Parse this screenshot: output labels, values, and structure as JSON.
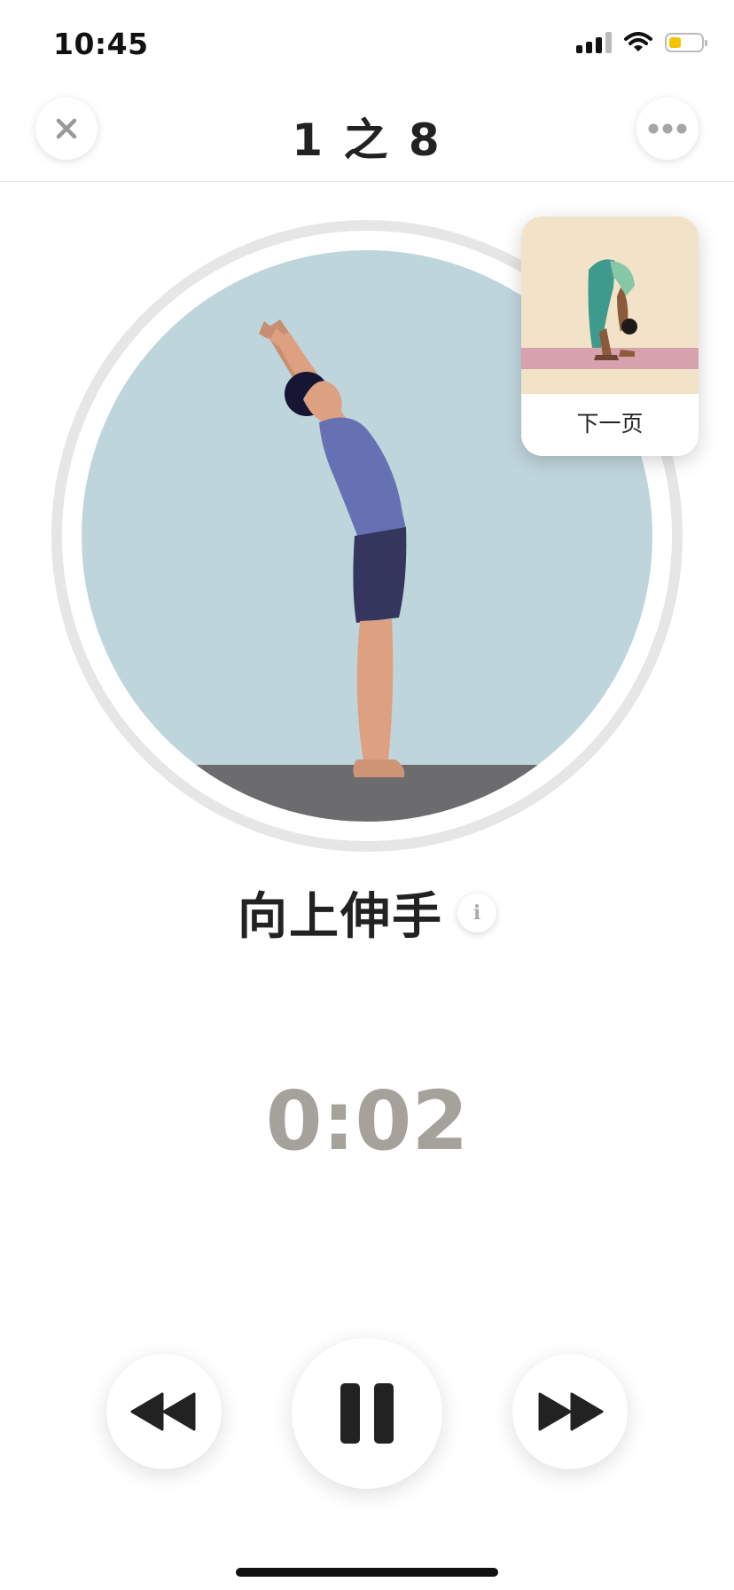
{
  "status_bar": {
    "time": "10:45",
    "icons": [
      "signal-icon",
      "wifi-icon",
      "battery-icon"
    ],
    "battery_level": 0.35,
    "battery_color": "#f5c400"
  },
  "header": {
    "title": "1 之 8",
    "close_icon": "close-icon",
    "more_icon": "more-icon"
  },
  "pose": {
    "name": "向上伸手",
    "info_icon_glyph": "i",
    "progress_fraction": 0.18,
    "circle_bg": "#bfd5dc",
    "ring_color": "#a5a29c",
    "ring_track_color": "#e6e6e6"
  },
  "next_card": {
    "label": "下一页"
  },
  "timer": "0:02",
  "controls": {
    "rewind_icon": "rewind-icon",
    "pause_icon": "pause-icon",
    "forward_icon": "fast-forward-icon"
  }
}
